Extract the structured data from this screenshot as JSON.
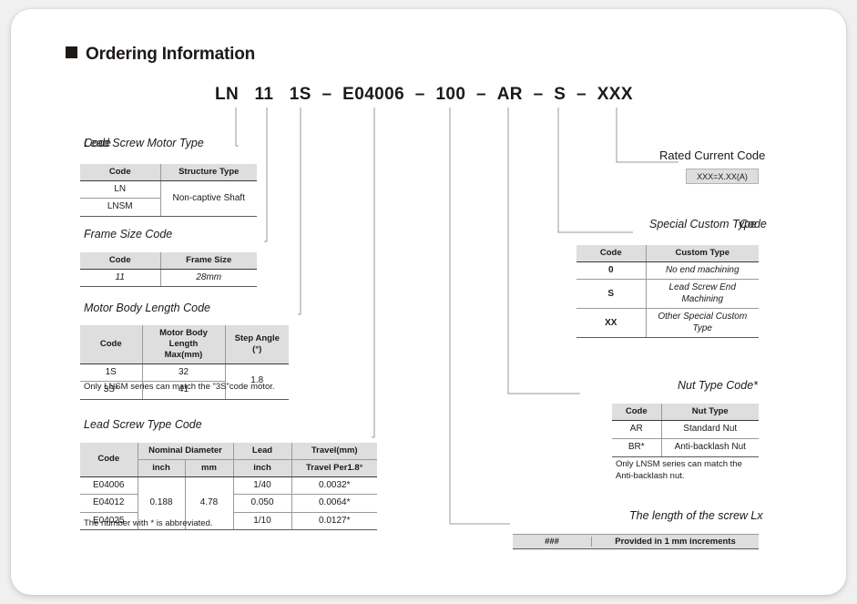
{
  "heading": {
    "label": "Ordering Information",
    "bullet": "filled-square"
  },
  "part_number": {
    "segments": [
      "LN",
      "11",
      "1S",
      "E04006",
      "100",
      "AR",
      "S",
      "XXX"
    ],
    "separator": "–",
    "full": "LN 11 1S – E04006 – 100 – AR – S – XXX"
  },
  "sections": {
    "motor_type": {
      "title_primary": "Lead Screw Motor Type",
      "title_overlay": "Code",
      "columns": [
        "Code",
        "Structure Type"
      ],
      "rows": [
        {
          "code": "LN",
          "structure": "Non-captive Shaft"
        },
        {
          "code": "LNSM",
          "structure": ""
        }
      ],
      "merged_structure_value": "Non-captive Shaft"
    },
    "frame_size": {
      "title": "Frame Size Code",
      "columns": [
        "Code",
        "Frame Size"
      ],
      "rows": [
        {
          "code": "11",
          "frame_size": "28mm"
        }
      ]
    },
    "motor_body_length": {
      "title": "Motor Body Length Code",
      "columns": [
        "Code",
        "Motor Body Length Max(mm)",
        "Step Angle (°)"
      ],
      "col_code": "Code",
      "col_len_l1": "Motor Body Length",
      "col_len_l2": "Max(mm)",
      "col_step_l1": "Step Angle",
      "col_step_l2": "(°)",
      "rows": [
        {
          "code": "1S",
          "length": "32"
        },
        {
          "code": "3S*",
          "length": "41"
        }
      ],
      "step_angle": "1.8",
      "note": "Only LNSM series can match the \"3S\"code motor."
    },
    "lead_screw": {
      "title": "Lead Screw Type Code",
      "col_code": "Code",
      "col_nominal": "Nominal Diameter",
      "col_nominal_inch": "inch",
      "col_nominal_mm": "mm",
      "col_lead": "Lead",
      "col_lead_inch": "inch",
      "col_travel": "Travel(mm)",
      "col_travel_sub": "Travel Per1.8°",
      "nominal_inch": "0.188",
      "nominal_mm": "4.78",
      "rows": [
        {
          "code": "E04006",
          "lead": "1/40",
          "travel": "0.0032*"
        },
        {
          "code": "E04012",
          "lead": "0.050",
          "travel": "0.0064*"
        },
        {
          "code": "E04025",
          "lead": "1/10",
          "travel": "0.0127*"
        }
      ],
      "note": "The number with * is abbreviated."
    },
    "rated_current": {
      "title": "Rated Current Code",
      "box_value": "XXX=X.XX(A)"
    },
    "special_custom": {
      "title_primary": "Special Custom Type",
      "title_overlay": "Code",
      "columns": [
        "Code",
        "Custom Type"
      ],
      "rows": [
        {
          "code": "0",
          "custom_type": "No end machining"
        },
        {
          "code": "S",
          "custom_type": "Lead Screw End Machining"
        },
        {
          "code": "XX",
          "custom_type": "Other Special Custom Type"
        }
      ]
    },
    "nut_type": {
      "title": "Nut Type Code*",
      "columns": [
        "Code",
        "Nut Type"
      ],
      "rows": [
        {
          "code": "AR",
          "nut_type": "Standard Nut"
        },
        {
          "code": "BR*",
          "nut_type": "Anti-backlash Nut"
        }
      ],
      "note": "Only LNSM series can match the Anti-backlash nut."
    },
    "screw_length": {
      "title": "The length of the screw Lx",
      "code": "###",
      "description": "Provided in 1 mm increments"
    }
  },
  "colors": {
    "text": "#1d1917",
    "header_fill": "#dedede",
    "rule": "#9a9a9a",
    "page_bg": "#ffffff",
    "canvas_bg": "#f0f0f0"
  }
}
